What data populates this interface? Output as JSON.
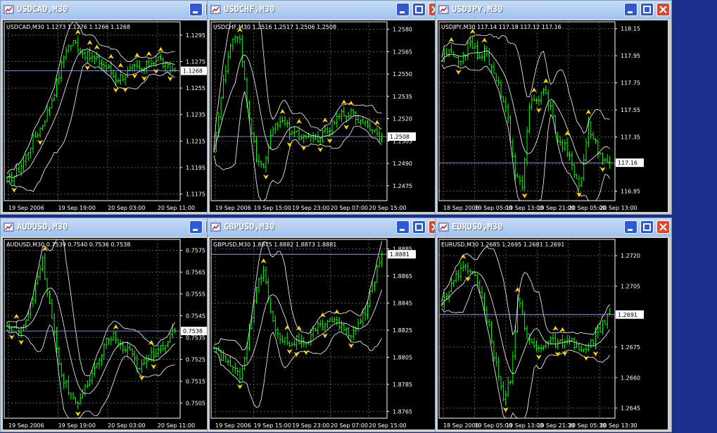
{
  "colors": {
    "background": "#000000",
    "candles": "#00ff00",
    "bands": "#ffffff",
    "arrows": "#ffd700",
    "grid": "#5a5a5a",
    "price_line": "#b0b0ff"
  },
  "icons": {
    "window": "chart-window-icon",
    "minimize": "minimize-icon",
    "maximize": "maximize-icon",
    "close": "close-icon",
    "fractal_up": "fractal-up-arrow-icon",
    "fractal_down": "fractal-down-arrow-icon"
  },
  "windows": [
    {
      "title": "USDCAD,M30",
      "info": "USDCAD,M30  1.1273 1.1276 1.1266 1.1268",
      "yticks": [
        "1.1295",
        "1.1275",
        "1.1255",
        "1.1235",
        "1.1215",
        "1.1195",
        "1.1175"
      ],
      "ymin": 1.117,
      "ymax": 1.1305,
      "current": "1.1268",
      "current_value": 1.1268,
      "xticks": [
        "19 Sep 2006",
        "19 Sep 19:00",
        "20 Sep 03:00",
        "20 Sep 11:00"
      ],
      "close": [
        1.1185,
        1.119,
        1.12,
        1.1215,
        1.1225,
        1.124,
        1.126,
        1.1285,
        1.129,
        1.1282,
        1.1278,
        1.1275,
        1.127,
        1.1262,
        1.1265,
        1.127,
        1.1268,
        1.1274,
        1.1278,
        1.127,
        1.1268
      ]
    },
    {
      "title": "USDCHF,M30",
      "info": "USDCHF,M30  1.2516 1.2517 1.2506 1.2508",
      "yticks": [
        "1.2580",
        "1.2565",
        "1.2550",
        "1.2535",
        "1.2520",
        "1.2505",
        "1.2490",
        "1.2475"
      ],
      "ymin": 1.2465,
      "ymax": 1.2585,
      "current": "1.2508",
      "current_value": 1.2508,
      "xticks": [
        "19 Sep 2006",
        "19 Sep 15:00",
        "19 Sep 23:00",
        "20 Sep 07:00",
        "20 Sep 15:00"
      ],
      "close": [
        1.25,
        1.254,
        1.257,
        1.2575,
        1.253,
        1.2495,
        1.2485,
        1.2515,
        1.252,
        1.2512,
        1.251,
        1.2505,
        1.2507,
        1.2509,
        1.2515,
        1.2522,
        1.2525,
        1.252,
        1.2518,
        1.2512,
        1.2508
      ]
    },
    {
      "title": "USDJPY,M30",
      "info": "USDJPY,M30  117.14 117.18 117.12 117.16",
      "yticks": [
        "118.15",
        "117.95",
        "117.75",
        "117.55",
        "117.35",
        "117.15",
        "116.95"
      ],
      "ymin": 116.88,
      "ymax": 118.2,
      "current": "117.16",
      "current_value": 117.16,
      "xticks": [
        "18 Sep 2006",
        "19 Sep 05:00",
        "19 Sep 13:00",
        "19 Sep 21:00",
        "20 Sep 05:00",
        "20 Sep 13:00"
      ],
      "close": [
        117.92,
        117.98,
        117.9,
        117.96,
        118.05,
        117.95,
        117.98,
        117.82,
        117.7,
        117.5,
        117.05,
        117.0,
        117.6,
        117.62,
        117.7,
        117.55,
        117.3,
        117.28,
        117.1,
        116.98,
        117.45,
        117.3,
        117.18,
        117.16
      ]
    },
    {
      "title": "AUDUSD,M30",
      "info": "AUDUSD,M30  0.7539 0.7540 0.7536 0.7538",
      "yticks": [
        "0.7575",
        "0.7565",
        "0.7555",
        "0.7545",
        "0.7535",
        "0.7525",
        "0.7515",
        "0.7505"
      ],
      "ymin": 0.7498,
      "ymax": 0.758,
      "current": "0.7538",
      "current_value": 0.7538,
      "xticks": [
        "19 Sep 2006",
        "19 Sep 19:00",
        "20 Sep 03:00",
        "20 Sep 11:00"
      ],
      "close": [
        0.754,
        0.7538,
        0.7542,
        0.7555,
        0.757,
        0.7545,
        0.752,
        0.751,
        0.7505,
        0.7512,
        0.752,
        0.7532,
        0.7536,
        0.753,
        0.7528,
        0.752,
        0.7525,
        0.753,
        0.7533,
        0.7538
      ]
    },
    {
      "title": "GBPUSD,M30",
      "info": "GBPUSD,M30  1.8875 1.8882 1.8873 1.8881",
      "yticks": [
        "1.8885",
        "1.8865",
        "1.8845",
        "1.8825",
        "1.8805",
        "1.8785",
        "1.8765"
      ],
      "ymin": 1.876,
      "ymax": 1.8892,
      "current": "1.8881",
      "current_value": 1.8881,
      "xticks": [
        "19 Sep 2006",
        "19 Sep 15:00",
        "19 Sep 23:00",
        "20 Sep 07:00",
        "20 Sep 15:00"
      ],
      "close": [
        1.881,
        1.8805,
        1.88,
        1.879,
        1.8815,
        1.8855,
        1.887,
        1.883,
        1.882,
        1.8815,
        1.8818,
        1.8812,
        1.8825,
        1.883,
        1.8834,
        1.8828,
        1.8822,
        1.8826,
        1.8838,
        1.886,
        1.8881
      ]
    },
    {
      "title": "EURUSD,M30",
      "info": "EURUSD,M30  1.2685 1.2695 1.2681 1.2691",
      "yticks": [
        "1.2720",
        "1.2705",
        "1.2690",
        "1.2675",
        "1.2660",
        "1.2645"
      ],
      "ymin": 1.264,
      "ymax": 1.2728,
      "current": "1.2691",
      "current_value": 1.2691,
      "xticks": [
        "18 Sep 2006",
        "19 Sep 05:00",
        "19 Sep 13:00",
        "19 Sep 21:30",
        "20 Sep 05:30",
        "20 Sep 13:30"
      ],
      "close": [
        1.2698,
        1.2704,
        1.271,
        1.2716,
        1.2712,
        1.2702,
        1.2688,
        1.2668,
        1.265,
        1.266,
        1.27,
        1.2682,
        1.2675,
        1.2676,
        1.2678,
        1.2677,
        1.2676,
        1.2677,
        1.2674,
        1.2673,
        1.268,
        1.2686,
        1.2691
      ]
    }
  ]
}
